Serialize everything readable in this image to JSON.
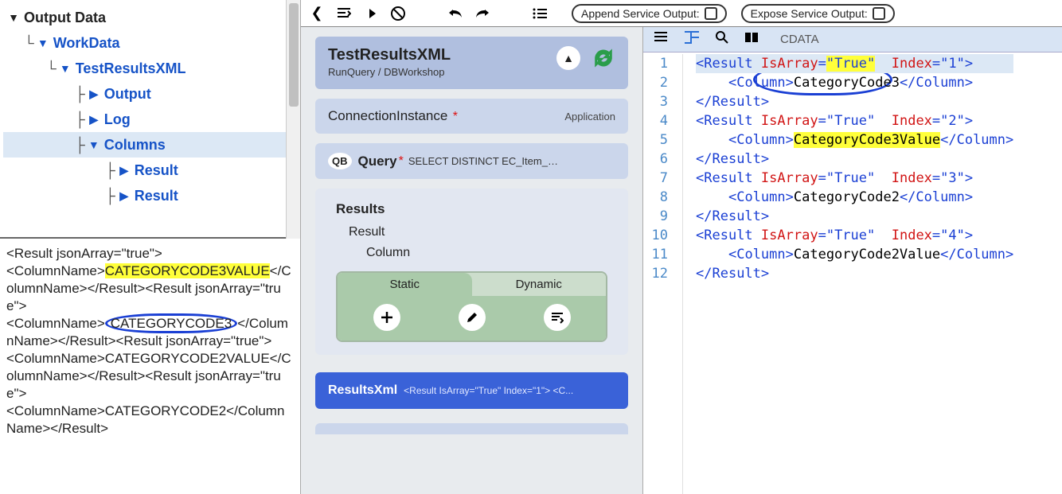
{
  "tree": {
    "root": "Output Data",
    "items": [
      {
        "label": "WorkData"
      },
      {
        "label": "TestResultsXML"
      },
      {
        "label": "Output"
      },
      {
        "label": "Log"
      },
      {
        "label": "Columns"
      },
      {
        "label": "Result"
      },
      {
        "label": "Result"
      }
    ]
  },
  "left_xml": {
    "l1": "<Result jsonArray=\"true\">",
    "l2a": "<ColumnName>",
    "l2_hl": "CATEGORYCODE3VALUE",
    "l2b": "</ColumnName></Result><Result jsonArray=\"true\">",
    "l4a": "<ColumnName>",
    "l4_circ": "CATEGORYCODE3",
    "l4b": "</ColumnName></Result><Result jsonArray=\"true\">",
    "l6": "<ColumnName>CATEGORYCODE2VALUE</ColumnName></Result><Result jsonArray=\"true\">",
    "l8": "<ColumnName>CATEGORYCODE2</ColumnName></Result>"
  },
  "top_strip": {
    "append_label": "Append Service Output:",
    "expose_label": "Expose Service Output:"
  },
  "center": {
    "title": "TestResultsXML",
    "subtitle": "RunQuery / DBWorkshop",
    "conn_label": "ConnectionInstance",
    "conn_right": "Application",
    "qb": "QB",
    "query_label": "Query",
    "query_text": "SELECT DISTINCT  EC_Item_Branch....",
    "results_label": "Results",
    "result_label": "Result",
    "column_label": "Column",
    "static_label": "Static",
    "dynamic_label": "Dynamic",
    "resultsxml_label": "ResultsXml",
    "resultsxml_mono": "<Result IsArray=\"True\" Index=\"1\">  <C..."
  },
  "right_header": {
    "cdata_label": "CDATA"
  },
  "code": {
    "l1": {
      "indent": "",
      "open": "<",
      "tag": "Result",
      "sp": " ",
      "attr1": "IsArray",
      "eq": "=",
      "val1": "\"True\"",
      "attr2": "Index",
      "val2": "\"1\"",
      "close": ">"
    },
    "l2": {
      "indent": "    ",
      "open": "<",
      "tag": "Column",
      "close": ">",
      "text": "CategoryCode3",
      "end": "</",
      "endclose": ">"
    },
    "l3": {
      "indent": "",
      "end": "</",
      "tag": "Result",
      "close": ">"
    },
    "l4": {
      "indent": "",
      "open": "<",
      "tag": "Result",
      "sp": " ",
      "attr1": "IsArray",
      "val1": "\"True\"",
      "attr2": "Index",
      "val2": "\"2\"",
      "close": ">"
    },
    "l5": {
      "indent": "    ",
      "open": "<",
      "tag": "Column",
      "close": ">",
      "text": "CategoryCode3Value",
      "end": "</",
      "endclose": ">"
    },
    "l6": {
      "indent": "",
      "end": "</",
      "tag": "Result",
      "close": ">"
    },
    "l7": {
      "indent": "",
      "open": "<",
      "tag": "Result",
      "sp": " ",
      "attr1": "IsArray",
      "val1": "\"True\"",
      "attr2": "Index",
      "val2": "\"3\"",
      "close": ">"
    },
    "l8": {
      "indent": "    ",
      "open": "<",
      "tag": "Column",
      "close": ">",
      "text": "CategoryCode2",
      "end": "</",
      "endclose": ">"
    },
    "l9": {
      "indent": "",
      "end": "</",
      "tag": "Result",
      "close": ">"
    },
    "l10": {
      "indent": "",
      "open": "<",
      "tag": "Result",
      "sp": " ",
      "attr1": "IsArray",
      "val1": "\"True\"",
      "attr2": "Index",
      "val2": "\"4\"",
      "close": ">"
    },
    "l11": {
      "indent": "    ",
      "open": "<",
      "tag": "Column",
      "close": ">",
      "text": "CategoryCode2Value",
      "end": "</",
      "endclose": ">"
    },
    "l12": {
      "indent": "",
      "end": "</",
      "tag": "Result",
      "close": ">"
    },
    "linenos": [
      "1",
      "2",
      "3",
      "4",
      "5",
      "6",
      "7",
      "8",
      "9",
      "10",
      "11",
      "12"
    ]
  }
}
